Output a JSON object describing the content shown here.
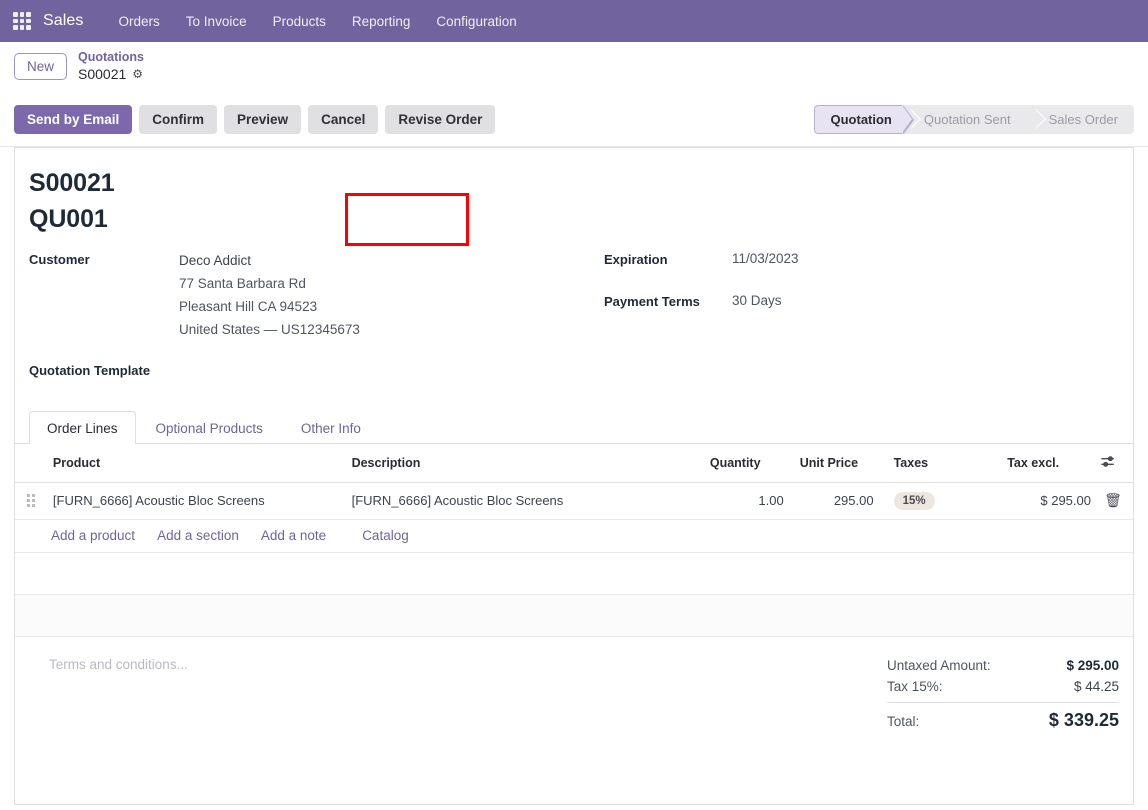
{
  "navbar": {
    "apps_icon": "apps-grid-icon",
    "brand": "Sales",
    "menus": [
      {
        "label": "Orders"
      },
      {
        "label": "To Invoice"
      },
      {
        "label": "Products"
      },
      {
        "label": "Reporting"
      },
      {
        "label": "Configuration"
      }
    ]
  },
  "breadcrumb": {
    "new_button": "New",
    "parent": "Quotations",
    "current": "S00021",
    "settings_icon": "gear-icon"
  },
  "control_panel": {
    "buttons": [
      {
        "label": "Send by Email",
        "style": "primary"
      },
      {
        "label": "Confirm",
        "style": "secondary"
      },
      {
        "label": "Preview",
        "style": "secondary"
      },
      {
        "label": "Cancel",
        "style": "secondary"
      },
      {
        "label": "Revise Order",
        "style": "secondary",
        "highlighted": true
      }
    ],
    "statusbar": [
      {
        "label": "Quotation",
        "active": true
      },
      {
        "label": "Quotation Sent",
        "active": false
      },
      {
        "label": "Sales Order",
        "active": false
      }
    ]
  },
  "record": {
    "title_line1": "S00021",
    "title_line2": "QU001",
    "fields": {
      "customer_label": "Customer",
      "customer_name": "Deco Addict",
      "customer_address": [
        "77 Santa Barbara Rd",
        "Pleasant Hill CA 94523",
        "United States — US12345673"
      ],
      "quotation_template_label": "Quotation Template",
      "quotation_template_value": "",
      "expiration_label": "Expiration",
      "expiration_value": "11/03/2023",
      "payment_terms_label": "Payment Terms",
      "payment_terms_value": "30 Days"
    }
  },
  "notebook": {
    "tabs": [
      {
        "label": "Order Lines",
        "active": true
      },
      {
        "label": "Optional Products",
        "active": false
      },
      {
        "label": "Other Info",
        "active": false
      }
    ]
  },
  "order_lines": {
    "columns": {
      "product": "Product",
      "description": "Description",
      "quantity": "Quantity",
      "unit_price": "Unit Price",
      "taxes": "Taxes",
      "tax_excl": "Tax excl.",
      "options_icon": "sliders-icon"
    },
    "rows": [
      {
        "drag_handle_icon": "drag-handle-icon",
        "product": "[FURN_6666] Acoustic Bloc Screens",
        "description": "[FURN_6666] Acoustic Bloc Screens",
        "quantity": "1.00",
        "unit_price": "295.00",
        "taxes": "15%",
        "tax_excl": "$ 295.00",
        "delete_icon": "trash-icon"
      }
    ],
    "adders": [
      {
        "label": "Add a product"
      },
      {
        "label": "Add a section"
      },
      {
        "label": "Add a note"
      },
      {
        "label": "Catalog"
      }
    ]
  },
  "footer": {
    "terms_placeholder": "Terms and conditions...",
    "totals": [
      {
        "label": "Untaxed Amount:",
        "value": "$ 295.00"
      },
      {
        "label": "Tax 15%:",
        "value": "$ 44.25"
      },
      {
        "label": "Total:",
        "value": "$ 339.25"
      }
    ]
  },
  "colors": {
    "brand_purple": "#71639e",
    "primary_button": "#7d68ab",
    "secondary_button": "#e0e0e3",
    "highlight_red": "#fe0000",
    "tax_badge_bg": "#ede7e0",
    "link_purple": "#71639e"
  }
}
